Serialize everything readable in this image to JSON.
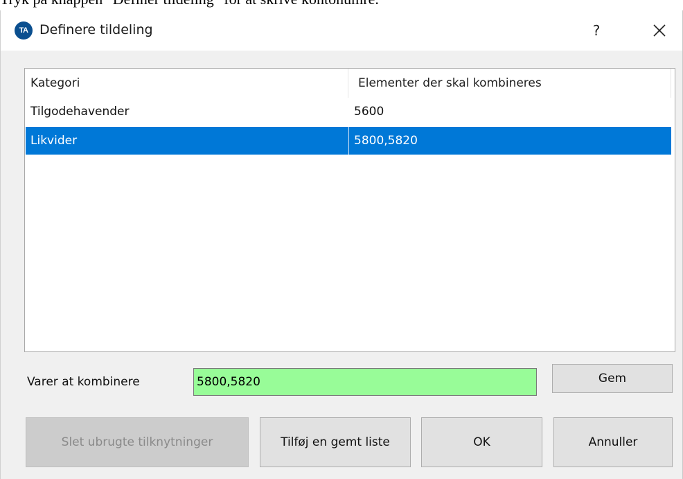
{
  "document": {
    "instruction_text": "Tryk på knappen \"Definer tildeling\" for at skrive kontonumre."
  },
  "dialog": {
    "title": "Definere tildeling",
    "app_icon_text": "TA",
    "help_label": "?",
    "close_icon": "close-icon"
  },
  "listview": {
    "columns": [
      "Kategori",
      "Elementer der skal kombineres"
    ],
    "rows": [
      {
        "category": "Tilgodehavender",
        "items": "5600",
        "selected": false
      },
      {
        "category": "Likvider",
        "items": "5800,5820",
        "selected": true
      }
    ]
  },
  "combine": {
    "label": "Varer at kombinere",
    "value": "5800,5820",
    "field_color": "#98fc98"
  },
  "buttons": {
    "save": "Gem",
    "delete_unused": "Slet ubrugte tilknytninger",
    "add_saved_list": "Tilføj en gemt liste",
    "ok": "OK",
    "cancel": "Annuller"
  },
  "colors": {
    "selection": "#0078d7",
    "app_icon": "#0b4f8f"
  }
}
